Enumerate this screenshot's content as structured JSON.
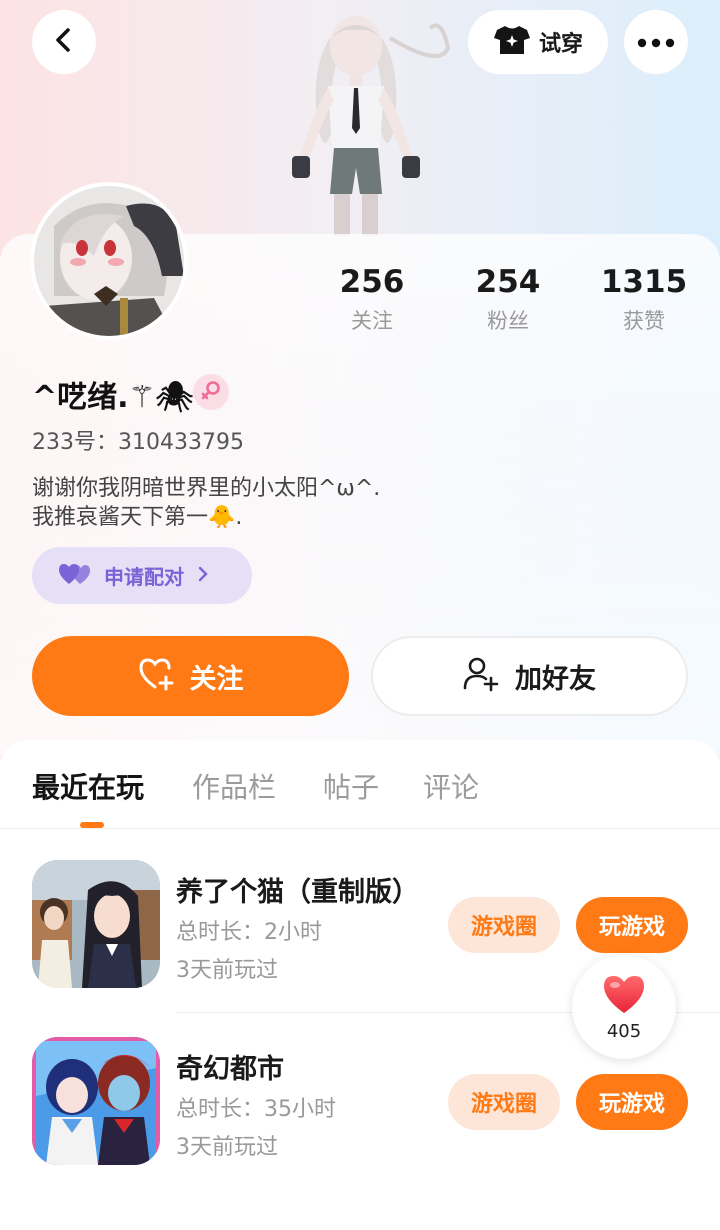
{
  "header": {
    "back_icon": "chevron-left-icon",
    "tryon_label": "试穿",
    "tryon_icon": "tshirt-sparkle-icon",
    "more_icon": "more-dots-icon"
  },
  "profile": {
    "nickname": "^呓绪.⚚🕷",
    "gender": "female",
    "id_label": "233号：310433795",
    "bio_line1": "谢谢你我阴暗世界里的小太阳^ω^.",
    "bio_line2": "我推哀酱天下第一🐥.",
    "pair_label": "申请配对"
  },
  "stats": [
    {
      "value": "256",
      "label": "关注"
    },
    {
      "value": "254",
      "label": "粉丝"
    },
    {
      "value": "1315",
      "label": "获赞"
    }
  ],
  "actions": {
    "follow_label": "关注",
    "add_friend_label": "加好友"
  },
  "tabs": [
    {
      "label": "最近在玩",
      "active": true
    },
    {
      "label": "作品栏",
      "active": false
    },
    {
      "label": "帖子",
      "active": false
    },
    {
      "label": "评论",
      "active": false
    }
  ],
  "games": [
    {
      "title": "养了个猫（重制版）",
      "duration": "总时长：2小时",
      "last_played": "3天前玩过",
      "circle_label": "游戏圈",
      "play_label": "玩游戏"
    },
    {
      "title": "奇幻都市",
      "duration": "总时长：35小时",
      "last_played": "3天前玩过",
      "circle_label": "游戏圈",
      "play_label": "玩游戏"
    }
  ],
  "like": {
    "count": "405",
    "icon": "heart-icon"
  },
  "colors": {
    "accent": "#ff7a14",
    "pair_purple": "#7a63d6",
    "gender_pink": "#f06b97"
  }
}
